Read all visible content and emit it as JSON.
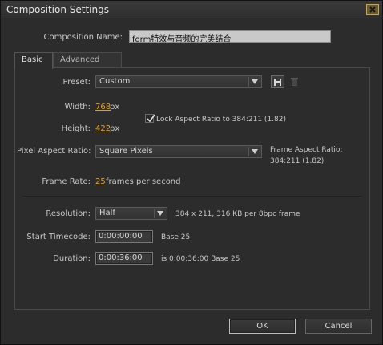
{
  "window": {
    "title": "Composition Settings",
    "close_icon": "close-icon"
  },
  "composition_name": {
    "label": "Composition Name:",
    "value": "form特效与音频的完美结合"
  },
  "tabs": [
    {
      "label": "Basic"
    },
    {
      "label": "Advanced"
    }
  ],
  "preset": {
    "label": "Preset:",
    "value": "Custom",
    "save_icon": "save-preset-icon",
    "delete_icon": "trash-icon"
  },
  "width": {
    "label": "Width:",
    "value": "768",
    "unit": "px"
  },
  "height": {
    "label": "Height:",
    "value": "422",
    "unit": "px"
  },
  "lock_aspect": {
    "label": "Lock Aspect Ratio to 384:211 (1.82)",
    "checked": true
  },
  "pixel_aspect": {
    "label": "Pixel Aspect Ratio:",
    "value": "Square Pixels",
    "frame_aspect_label": "Frame Aspect Ratio:",
    "frame_aspect_value": "384:211 (1.82)"
  },
  "frame_rate": {
    "label": "Frame Rate:",
    "value": "25",
    "suffix": "frames per second"
  },
  "resolution": {
    "label": "Resolution:",
    "value": "Half",
    "info": "384 x 211, 316 KB per 8bpc frame"
  },
  "start_timecode": {
    "label": "Start Timecode:",
    "value": "0:00:00:00",
    "base": "Base 25"
  },
  "duration": {
    "label": "Duration:",
    "value": "0:00:36:00",
    "info": "is 0:00:36:00  Base 25"
  },
  "buttons": {
    "ok": "OK",
    "cancel": "Cancel"
  }
}
